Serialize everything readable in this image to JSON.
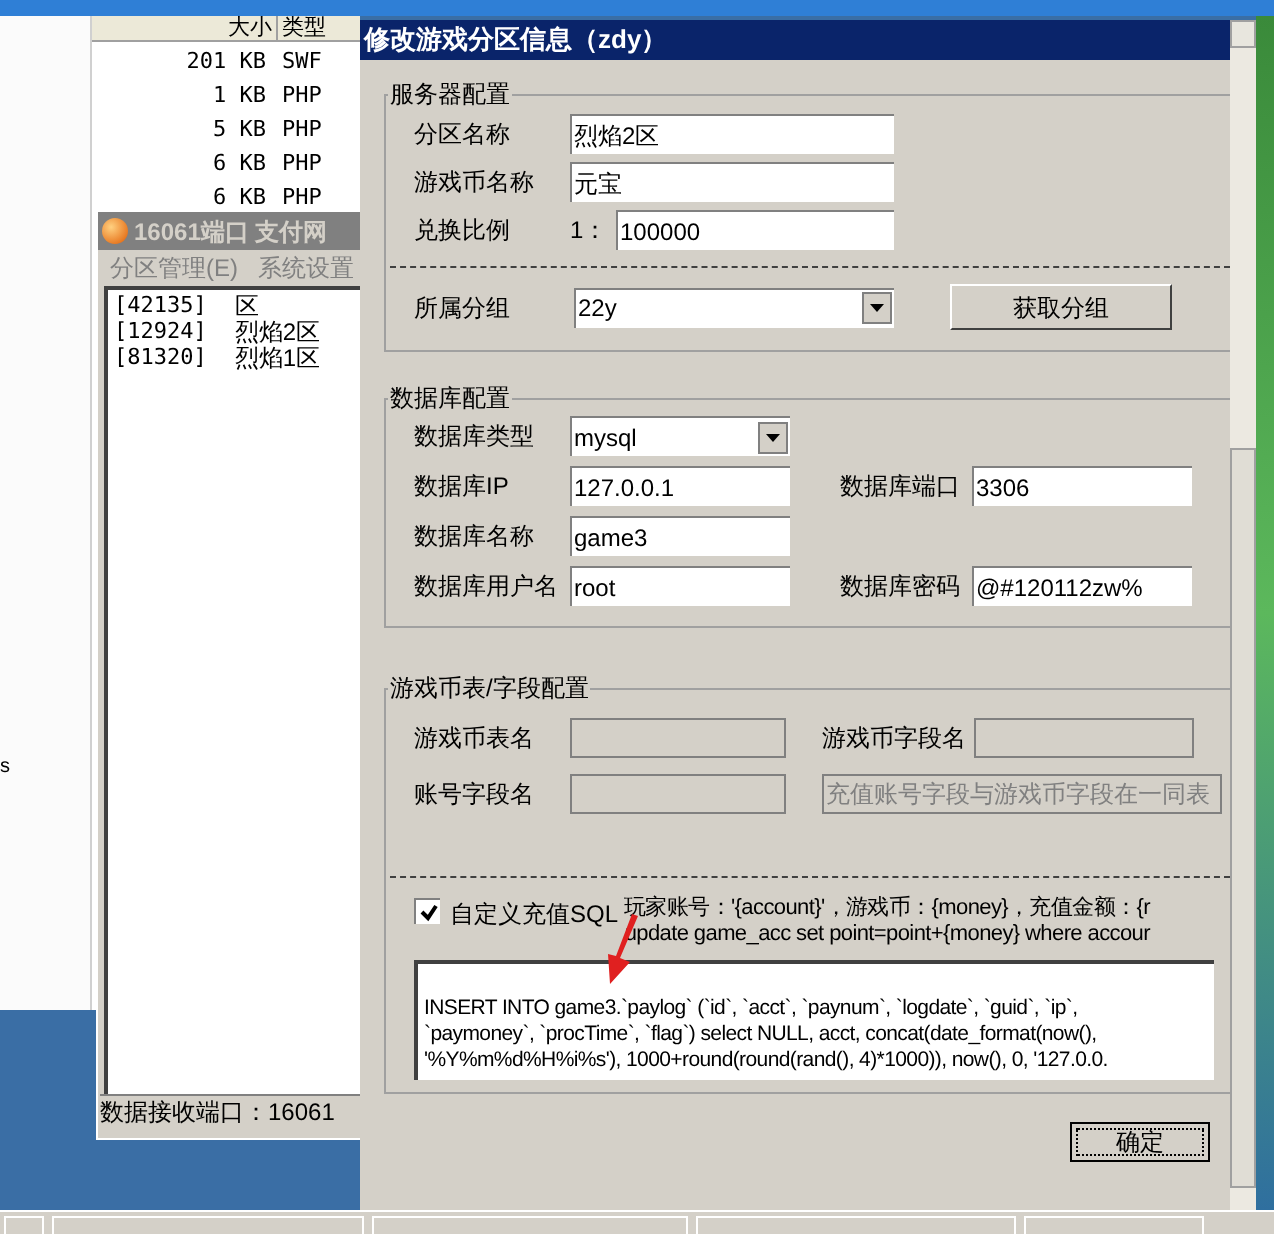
{
  "explorer": {
    "columns": [
      "大小",
      "类型"
    ],
    "rows": [
      {
        "size": "201 KB",
        "type": "SWF"
      },
      {
        "size": "1 KB",
        "type": "PHP"
      },
      {
        "size": "5 KB",
        "type": "PHP"
      },
      {
        "size": "6 KB",
        "type": "PHP"
      },
      {
        "size": "6 KB",
        "type": "PHP"
      }
    ],
    "stray_text": "s"
  },
  "port_window": {
    "title": "16061端口 支付网",
    "active": false,
    "menu": [
      "分区管理(E)",
      "系统设置"
    ],
    "zones": [
      {
        "id": "[42135]",
        "name": "区"
      },
      {
        "id": "[12924]",
        "name": "烈焰2区"
      },
      {
        "id": "[81320]",
        "name": "烈焰1区"
      }
    ],
    "status": "数据接收端口：16061"
  },
  "dialog": {
    "title": "修改游戏分区信息（zdy）",
    "active": true,
    "server_group": {
      "legend": "服务器配置",
      "zone_name": {
        "label": "分区名称",
        "value": "烈焰2区"
      },
      "currency_name": {
        "label": "游戏币名称",
        "value": "元宝"
      },
      "ratio": {
        "label": "兑换比例",
        "prefix": "1：",
        "value": "100000"
      },
      "group": {
        "label": "所属分组",
        "value": "22y"
      },
      "fetch_button": "获取分组"
    },
    "db_group": {
      "legend": "数据库配置",
      "rows": [
        [
          {
            "label": "数据库类型",
            "value": "mysql",
            "kind": "select"
          }
        ],
        [
          {
            "label": "数据库IP",
            "value": "127.0.0.1",
            "kind": "text"
          },
          {
            "label": "数据库端口",
            "value": "3306",
            "kind": "text"
          }
        ],
        [
          {
            "label": "数据库名称",
            "value": "game3",
            "kind": "text"
          }
        ],
        [
          {
            "label": "数据库用户名",
            "value": "root",
            "kind": "text"
          },
          {
            "label": "数据库密码",
            "value": "@#120112zw%",
            "kind": "text"
          }
        ]
      ]
    },
    "currency_group": {
      "legend": "游戏币表/字段配置",
      "rows": [
        [
          {
            "label": "游戏币表名",
            "disabled": true
          },
          {
            "label": "游戏币字段名",
            "disabled": true
          }
        ],
        [
          {
            "label": "账号字段名",
            "disabled": true
          },
          {
            "value": "充值账号字段与游戏币字段在一同表",
            "disabled": true
          }
        ]
      ]
    },
    "custom_sql": {
      "checked": true,
      "label": "自定义充值SQL",
      "hint_lines": [
        "玩家账号：'{account}'，游戏币：{money}，充值金额：{r",
        "update game_acc set point=point+{money} where accour"
      ],
      "sql_lines": [
        "INSERT INTO game3.`paylog` (`id`, `acct`, `paynum`, `logdate`, `guid`, `ip`,",
        "`paymoney`, `procTime`, `flag`) select NULL, acct, concat(date_format(now(),",
        "'%Y%m%d%H%i%s'), 1000+round(round(rand(), 4)*1000)), now(), 0, '127.0.0."
      ]
    },
    "ok_button": "确定"
  }
}
